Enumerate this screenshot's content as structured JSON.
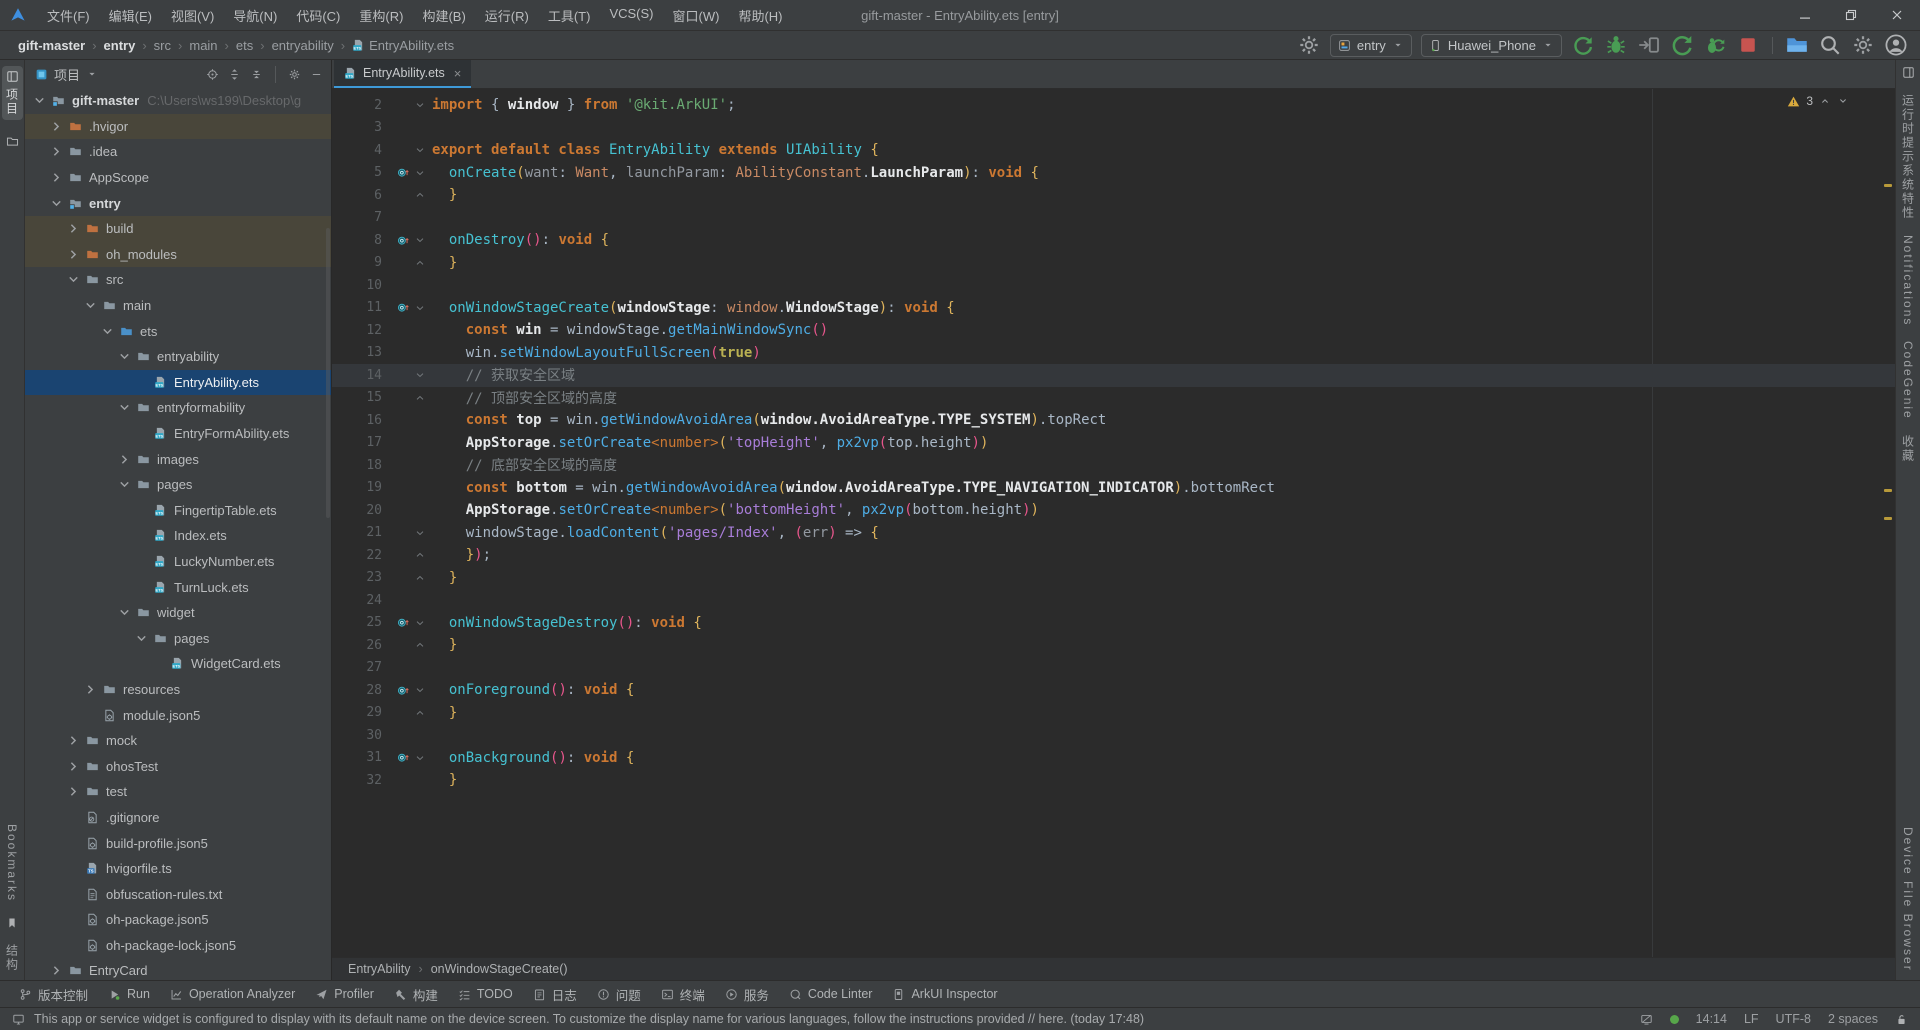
{
  "window": {
    "title": "gift-master - EntryAbility.ets [entry]"
  },
  "menus": [
    "文件(F)",
    "编辑(E)",
    "视图(V)",
    "导航(N)",
    "代码(C)",
    "重构(R)",
    "构建(B)",
    "运行(R)",
    "工具(T)",
    "VCS(S)",
    "窗口(W)",
    "帮助(H)"
  ],
  "breadcrumbs": [
    {
      "label": "gift-master",
      "bold": true
    },
    {
      "label": "entry",
      "bold": true
    },
    {
      "label": "src"
    },
    {
      "label": "main"
    },
    {
      "label": "ets"
    },
    {
      "label": "entryability"
    },
    {
      "label": "EntryAbility.ets",
      "icon": "ets"
    }
  ],
  "run_controls": {
    "module": "entry",
    "device": "Huawei_Phone"
  },
  "left_stripe": {
    "top_label": "项目",
    "bottom_labels": [
      "Bookmarks",
      "结构"
    ]
  },
  "right_stripe": {
    "top_labels": [
      "运行时提示系统特性",
      "Notifications",
      "CodeGenie",
      "收藏"
    ],
    "bottom_labels": [
      "Device File Browser"
    ]
  },
  "project": {
    "tool_label": "项目",
    "tree": [
      {
        "l": "gift-master",
        "lvl": 0,
        "c": "o",
        "i": "mod",
        "bold": true,
        "extra": "C:\\Users\\ws199\\Desktop\\g"
      },
      {
        "l": ".hvigor",
        "lvl": 1,
        "c": "x",
        "i": "foldex",
        "ex": true
      },
      {
        "l": ".idea",
        "lvl": 1,
        "c": "x",
        "i": "fold"
      },
      {
        "l": "AppScope",
        "lvl": 1,
        "c": "x",
        "i": "fold"
      },
      {
        "l": "entry",
        "lvl": 1,
        "c": "o",
        "i": "mod",
        "bold": true
      },
      {
        "l": "build",
        "lvl": 2,
        "c": "x",
        "i": "foldex",
        "ex": true
      },
      {
        "l": "oh_modules",
        "lvl": 2,
        "c": "x",
        "i": "foldex",
        "ex": true
      },
      {
        "l": "src",
        "lvl": 2,
        "c": "o",
        "i": "fold"
      },
      {
        "l": "main",
        "lvl": 3,
        "c": "o",
        "i": "fold"
      },
      {
        "l": "ets",
        "lvl": 4,
        "c": "o",
        "i": "foldsrc"
      },
      {
        "l": "entryability",
        "lvl": 5,
        "c": "o",
        "i": "fold"
      },
      {
        "l": "EntryAbility.ets",
        "lvl": 6,
        "c": null,
        "i": "ets",
        "sel": true
      },
      {
        "l": "entryformability",
        "lvl": 5,
        "c": "o",
        "i": "fold"
      },
      {
        "l": "EntryFormAbility.ets",
        "lvl": 6,
        "c": null,
        "i": "ets"
      },
      {
        "l": "images",
        "lvl": 5,
        "c": "x",
        "i": "fold"
      },
      {
        "l": "pages",
        "lvl": 5,
        "c": "o",
        "i": "fold"
      },
      {
        "l": "FingertipTable.ets",
        "lvl": 6,
        "c": null,
        "i": "ets"
      },
      {
        "l": "Index.ets",
        "lvl": 6,
        "c": null,
        "i": "ets"
      },
      {
        "l": "LuckyNumber.ets",
        "lvl": 6,
        "c": null,
        "i": "ets"
      },
      {
        "l": "TurnLuck.ets",
        "lvl": 6,
        "c": null,
        "i": "ets"
      },
      {
        "l": "widget",
        "lvl": 5,
        "c": "o",
        "i": "fold"
      },
      {
        "l": "pages",
        "lvl": 6,
        "c": "o",
        "i": "fold"
      },
      {
        "l": "WidgetCard.ets",
        "lvl": 7,
        "c": null,
        "i": "ets"
      },
      {
        "l": "resources",
        "lvl": 3,
        "c": "x",
        "i": "fold"
      },
      {
        "l": "module.json5",
        "lvl": 3,
        "c": null,
        "i": "json5"
      },
      {
        "l": "mock",
        "lvl": 2,
        "c": "x",
        "i": "fold"
      },
      {
        "l": "ohosTest",
        "lvl": 2,
        "c": "x",
        "i": "fold"
      },
      {
        "l": "test",
        "lvl": 2,
        "c": "x",
        "i": "fold"
      },
      {
        "l": ".gitignore",
        "lvl": 2,
        "c": null,
        "i": "git"
      },
      {
        "l": "build-profile.json5",
        "lvl": 2,
        "c": null,
        "i": "json5"
      },
      {
        "l": "hvigorfile.ts",
        "lvl": 2,
        "c": null,
        "i": "ts"
      },
      {
        "l": "obfuscation-rules.txt",
        "lvl": 2,
        "c": null,
        "i": "txt"
      },
      {
        "l": "oh-package.json5",
        "lvl": 2,
        "c": null,
        "i": "json5"
      },
      {
        "l": "oh-package-lock.json5",
        "lvl": 2,
        "c": null,
        "i": "json5"
      },
      {
        "l": "EntryCard",
        "lvl": 1,
        "c": "x",
        "i": "fold"
      }
    ]
  },
  "editor": {
    "tab": "EntryAbility.ets",
    "warnings": "3",
    "lines": [
      {
        "n": 2,
        "f": "o",
        "t": [
          [
            "k",
            "import "
          ],
          [
            "p",
            "{ "
          ],
          [
            "pb",
            "window"
          ],
          [
            "p",
            " } "
          ],
          [
            "k",
            "from "
          ],
          [
            "s",
            "'@kit.ArkUI'"
          ],
          [
            "p",
            ";"
          ]
        ]
      },
      {
        "n": 3,
        "t": []
      },
      {
        "n": 4,
        "f": "o",
        "t": [
          [
            "k",
            "export default class "
          ],
          [
            "cy",
            "EntryAbility "
          ],
          [
            "k",
            "extends "
          ],
          [
            "cy",
            "UIAbility "
          ],
          [
            "b1",
            "{"
          ]
        ]
      },
      {
        "n": 5,
        "g": 1,
        "f": "o",
        "t": [
          [
            "p",
            "  "
          ],
          [
            "cy",
            "onCreate"
          ],
          [
            "b1",
            "("
          ],
          [
            "gy",
            "want"
          ],
          [
            "p",
            ": "
          ],
          [
            "ty",
            "Want"
          ],
          [
            "p",
            ", "
          ],
          [
            "gy",
            "launchParam"
          ],
          [
            "p",
            ": "
          ],
          [
            "ty",
            "AbilityConstant"
          ],
          [
            "p",
            "."
          ],
          [
            "pb",
            "LaunchParam"
          ],
          [
            "b1",
            ")"
          ],
          [
            "p",
            ": "
          ],
          [
            "k",
            "void "
          ],
          [
            "b1",
            "{"
          ]
        ]
      },
      {
        "n": 6,
        "f": "c",
        "t": [
          [
            "p",
            "  "
          ],
          [
            "b1",
            "}"
          ]
        ]
      },
      {
        "n": 7,
        "t": []
      },
      {
        "n": 8,
        "g": 1,
        "f": "o",
        "t": [
          [
            "p",
            "  "
          ],
          [
            "cy",
            "onDestroy"
          ],
          [
            "b2",
            "()"
          ],
          [
            "p",
            ": "
          ],
          [
            "k",
            "void "
          ],
          [
            "b1",
            "{"
          ]
        ]
      },
      {
        "n": 9,
        "f": "c",
        "t": [
          [
            "p",
            "  "
          ],
          [
            "b1",
            "}"
          ]
        ]
      },
      {
        "n": 10,
        "t": []
      },
      {
        "n": 11,
        "g": 1,
        "f": "o",
        "t": [
          [
            "p",
            "  "
          ],
          [
            "cy",
            "onWindowStageCreate"
          ],
          [
            "b1",
            "("
          ],
          [
            "pb",
            "windowStage"
          ],
          [
            "p",
            ": "
          ],
          [
            "ty",
            "window"
          ],
          [
            "p",
            "."
          ],
          [
            "pb",
            "WindowStage"
          ],
          [
            "b1",
            ")"
          ],
          [
            "p",
            ": "
          ],
          [
            "k",
            "void "
          ],
          [
            "b1",
            "{"
          ]
        ]
      },
      {
        "n": 12,
        "t": [
          [
            "p",
            "    "
          ],
          [
            "k",
            "const "
          ],
          [
            "pb",
            "win"
          ],
          [
            "p",
            " = windowStage."
          ],
          [
            "fn",
            "getMainWindowSync"
          ],
          [
            "b2",
            "()"
          ]
        ]
      },
      {
        "n": 13,
        "t": [
          [
            "p",
            "    win."
          ],
          [
            "fn",
            "setWindowLayoutFullScreen"
          ],
          [
            "b2",
            "("
          ],
          [
            "kt",
            "true"
          ],
          [
            "b2",
            ")"
          ]
        ]
      },
      {
        "n": 14,
        "caret": 1,
        "f": "o",
        "t": [
          [
            "p",
            "    "
          ],
          [
            "c",
            "// 获取安全区域"
          ]
        ]
      },
      {
        "n": 15,
        "f": "c",
        "t": [
          [
            "p",
            "    "
          ],
          [
            "c",
            "// 顶部安全区域的高度"
          ]
        ]
      },
      {
        "n": 16,
        "t": [
          [
            "p",
            "    "
          ],
          [
            "k",
            "const "
          ],
          [
            "pb",
            "top"
          ],
          [
            "p",
            " = win."
          ],
          [
            "fn",
            "getWindowAvoidArea"
          ],
          [
            "b1",
            "("
          ],
          [
            "pb",
            "window.AvoidAreaType.TYPE_SYSTEM"
          ],
          [
            "b1",
            ")"
          ],
          [
            "p",
            ".topRect"
          ]
        ]
      },
      {
        "n": 17,
        "t": [
          [
            "p",
            "    "
          ],
          [
            "pb",
            "AppStorage"
          ],
          [
            "p",
            "."
          ],
          [
            "fn",
            "setOrCreate"
          ],
          [
            "k2",
            "<number>"
          ],
          [
            "b1",
            "("
          ],
          [
            "sp",
            "'topHeight'"
          ],
          [
            "p",
            ", "
          ],
          [
            "fn",
            "px2vp"
          ],
          [
            "b2",
            "("
          ],
          [
            "p",
            "top.height"
          ],
          [
            "b2",
            ")"
          ],
          [
            "b1",
            ")"
          ]
        ]
      },
      {
        "n": 18,
        "t": [
          [
            "p",
            "    "
          ],
          [
            "c",
            "// 底部安全区域的高度"
          ]
        ]
      },
      {
        "n": 19,
        "t": [
          [
            "p",
            "    "
          ],
          [
            "k",
            "const "
          ],
          [
            "pb",
            "bottom"
          ],
          [
            "p",
            " = win."
          ],
          [
            "fn",
            "getWindowAvoidArea"
          ],
          [
            "b1",
            "("
          ],
          [
            "pb",
            "window.AvoidAreaType.TYPE_NAVIGATION_INDICATOR"
          ],
          [
            "b1",
            ")"
          ],
          [
            "p",
            ".bottomRect"
          ]
        ]
      },
      {
        "n": 20,
        "t": [
          [
            "p",
            "    "
          ],
          [
            "pb",
            "AppStorage"
          ],
          [
            "p",
            "."
          ],
          [
            "fn",
            "setOrCreate"
          ],
          [
            "k2",
            "<number>"
          ],
          [
            "b1",
            "("
          ],
          [
            "sp",
            "'bottomHeight'"
          ],
          [
            "p",
            ", "
          ],
          [
            "fn",
            "px2vp"
          ],
          [
            "b2",
            "("
          ],
          [
            "p",
            "bottom.height"
          ],
          [
            "b2",
            ")"
          ],
          [
            "b1",
            ")"
          ]
        ]
      },
      {
        "n": 21,
        "f": "o",
        "t": [
          [
            "p",
            "    windowStage."
          ],
          [
            "fn",
            "loadContent"
          ],
          [
            "b1",
            "("
          ],
          [
            "sp",
            "'pages/Index'"
          ],
          [
            "p",
            ", "
          ],
          [
            "b2",
            "("
          ],
          [
            "gy",
            "err"
          ],
          [
            "b2",
            ")"
          ],
          [
            "p",
            " => "
          ],
          [
            "b1",
            "{"
          ]
        ]
      },
      {
        "n": 22,
        "f": "c",
        "t": [
          [
            "p",
            "    "
          ],
          [
            "b1",
            "}"
          ],
          [
            "b2",
            ")"
          ],
          [
            "p",
            ";"
          ]
        ]
      },
      {
        "n": 23,
        "f": "c",
        "t": [
          [
            "p",
            "  "
          ],
          [
            "b1",
            "}"
          ]
        ]
      },
      {
        "n": 24,
        "t": []
      },
      {
        "n": 25,
        "g": 1,
        "f": "o",
        "t": [
          [
            "p",
            "  "
          ],
          [
            "cy",
            "onWindowStageDestroy"
          ],
          [
            "b2",
            "()"
          ],
          [
            "p",
            ": "
          ],
          [
            "k",
            "void "
          ],
          [
            "b1",
            "{"
          ]
        ]
      },
      {
        "n": 26,
        "f": "c",
        "t": [
          [
            "p",
            "  "
          ],
          [
            "b1",
            "}"
          ]
        ]
      },
      {
        "n": 27,
        "t": []
      },
      {
        "n": 28,
        "g": 1,
        "f": "o",
        "t": [
          [
            "p",
            "  "
          ],
          [
            "cy",
            "onForeground"
          ],
          [
            "b2",
            "()"
          ],
          [
            "p",
            ": "
          ],
          [
            "k",
            "void "
          ],
          [
            "b1",
            "{"
          ]
        ]
      },
      {
        "n": 29,
        "f": "c",
        "t": [
          [
            "p",
            "  "
          ],
          [
            "b1",
            "}"
          ]
        ]
      },
      {
        "n": 30,
        "t": []
      },
      {
        "n": 31,
        "g": 1,
        "f": "o",
        "t": [
          [
            "p",
            "  "
          ],
          [
            "cy",
            "onBackground"
          ],
          [
            "b2",
            "()"
          ],
          [
            "p",
            ": "
          ],
          [
            "k",
            "void "
          ],
          [
            "b1",
            "{"
          ]
        ]
      },
      {
        "n": 32,
        "t": [
          [
            "p",
            "  "
          ],
          [
            "b1",
            "}"
          ]
        ]
      }
    ]
  },
  "editor_breadcrumb": [
    "EntryAbility",
    "onWindowStageCreate()"
  ],
  "bottom_bar": [
    {
      "i": "branch",
      "l": "版本控制"
    },
    {
      "i": "play",
      "l": "Run"
    },
    {
      "i": "chart",
      "l": "Operation Analyzer"
    },
    {
      "i": "plane",
      "l": "Profiler"
    },
    {
      "i": "hammer",
      "l": "构建"
    },
    {
      "i": "todo",
      "l": "TODO"
    },
    {
      "i": "log",
      "l": "日志"
    },
    {
      "i": "problem",
      "l": "问题"
    },
    {
      "i": "term",
      "l": "终端"
    },
    {
      "i": "services",
      "l": "服务"
    },
    {
      "i": "qlint",
      "l": "Code Linter"
    },
    {
      "i": "arkui",
      "l": "ArkUI Inspector"
    }
  ],
  "status_bar": {
    "message": "This app or service widget is configured to display with its default name on the device screen. To customize the display name for various languages, follow the instructions provided // here. (today 17:48)",
    "right": [
      "14:14",
      "LF",
      "UTF-8",
      "2 spaces"
    ]
  }
}
